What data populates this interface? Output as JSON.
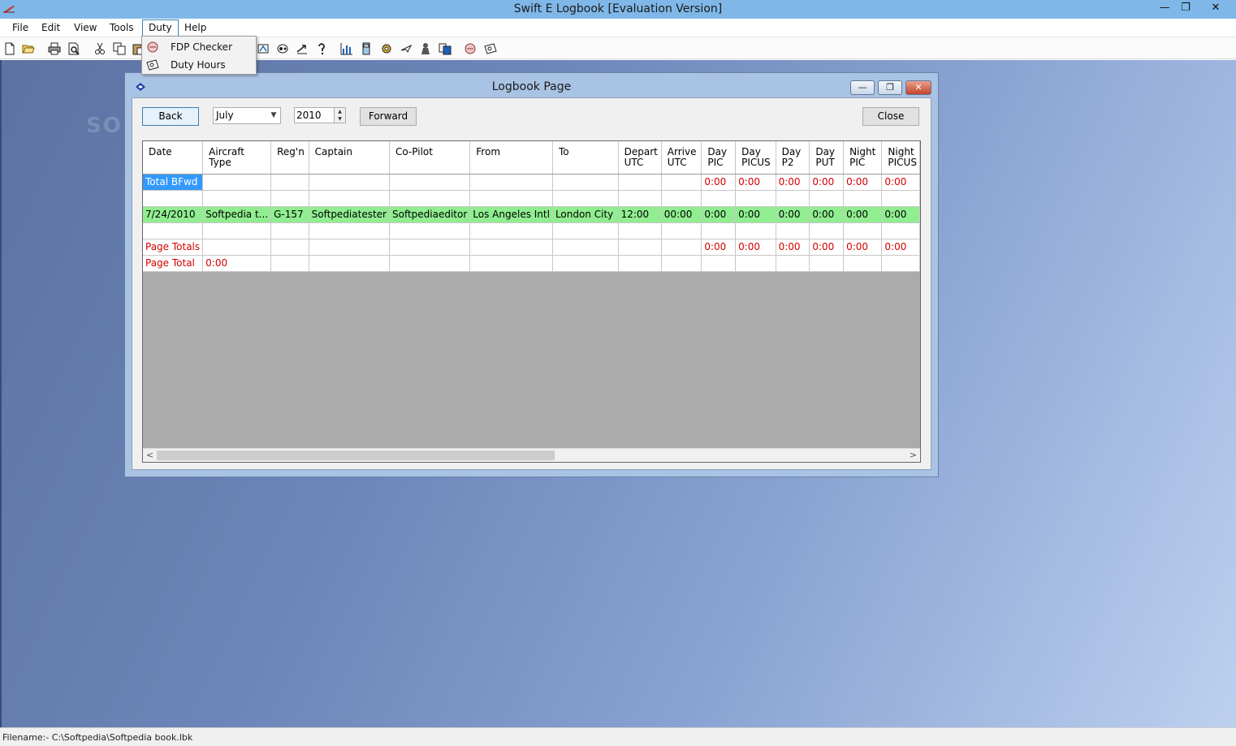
{
  "window": {
    "title": "Swift E Logbook [Evaluation Version]",
    "minimize_glyph": "—",
    "restore_glyph": "❐",
    "close_glyph": "✕"
  },
  "menubar": {
    "items": [
      "File",
      "Edit",
      "View",
      "Tools",
      "Duty",
      "Help"
    ],
    "active": "Duty"
  },
  "duty_menu": {
    "items": [
      {
        "label": "FDP Checker",
        "icon": "fdp-checker-icon"
      },
      {
        "label": "Duty Hours",
        "icon": "duty-hours-icon"
      }
    ]
  },
  "toolbar": {
    "icons": [
      "new-file-icon",
      "open-folder-icon",
      "print-icon",
      "print-preview-icon",
      "cut-icon",
      "copy-icon",
      "paste-icon",
      "aircraft-icon",
      "pilots-icon",
      "export-icon",
      "help-icon",
      "chart-icon",
      "calculator-icon",
      "settings-icon",
      "flight-icon",
      "crew-icon",
      "report-icon",
      "fdp-checker-icon",
      "duty-hours-icon"
    ]
  },
  "watermark": "SOFT",
  "logbook": {
    "title": "Logbook Page",
    "back_label": "Back",
    "month": "July",
    "year": "2010",
    "forward_label": "Forward",
    "close_label": "Close",
    "columns": [
      "Date",
      "Aircraft Type",
      "Reg'n",
      "Captain",
      "Co-Pilot",
      "From",
      "To",
      "Depart UTC",
      "Arrive UTC",
      "Day PIC",
      "Day PICUS",
      "Day P2",
      "Day PUT",
      "Night PIC",
      "Night PICUS"
    ],
    "rows": [
      {
        "type": "bfwd",
        "cells": [
          "Total BFwd",
          "",
          "",
          "",
          "",
          "",
          "",
          "",
          "",
          "0:00",
          "0:00",
          "0:00",
          "0:00",
          "0:00",
          "0:00"
        ]
      },
      {
        "type": "blank",
        "cells": [
          "",
          "",
          "",
          "",
          "",
          "",
          "",
          "",
          "",
          "",
          "",
          "",
          "",
          "",
          ""
        ]
      },
      {
        "type": "flight",
        "cells": [
          "7/24/2010",
          "Softpedia t...",
          "G-157",
          "Softpediatester",
          "Softpediaeditor",
          "Los Angeles Intl",
          "London City",
          "12:00",
          "00:00",
          "0:00",
          "0:00",
          "0:00",
          "0:00",
          "0:00",
          "0:00"
        ]
      },
      {
        "type": "blank",
        "cells": [
          "",
          "",
          "",
          "",
          "",
          "",
          "",
          "",
          "",
          "",
          "",
          "",
          "",
          "",
          ""
        ]
      },
      {
        "type": "totals",
        "cells": [
          "Page Totals",
          "",
          "",
          "",
          "",
          "",
          "",
          "",
          "",
          "0:00",
          "0:00",
          "0:00",
          "0:00",
          "0:00",
          "0:00"
        ]
      },
      {
        "type": "total",
        "cells": [
          "Page Total",
          "0:00",
          "",
          "",
          "",
          "",
          "",
          "",
          "",
          "",
          "",
          "",
          "",
          "",
          ""
        ]
      }
    ],
    "scroll_left": "<",
    "scroll_right": ">"
  },
  "statusbar": {
    "text": "Filename:- C:\\Softpedia\\Softpedia book.lbk"
  }
}
